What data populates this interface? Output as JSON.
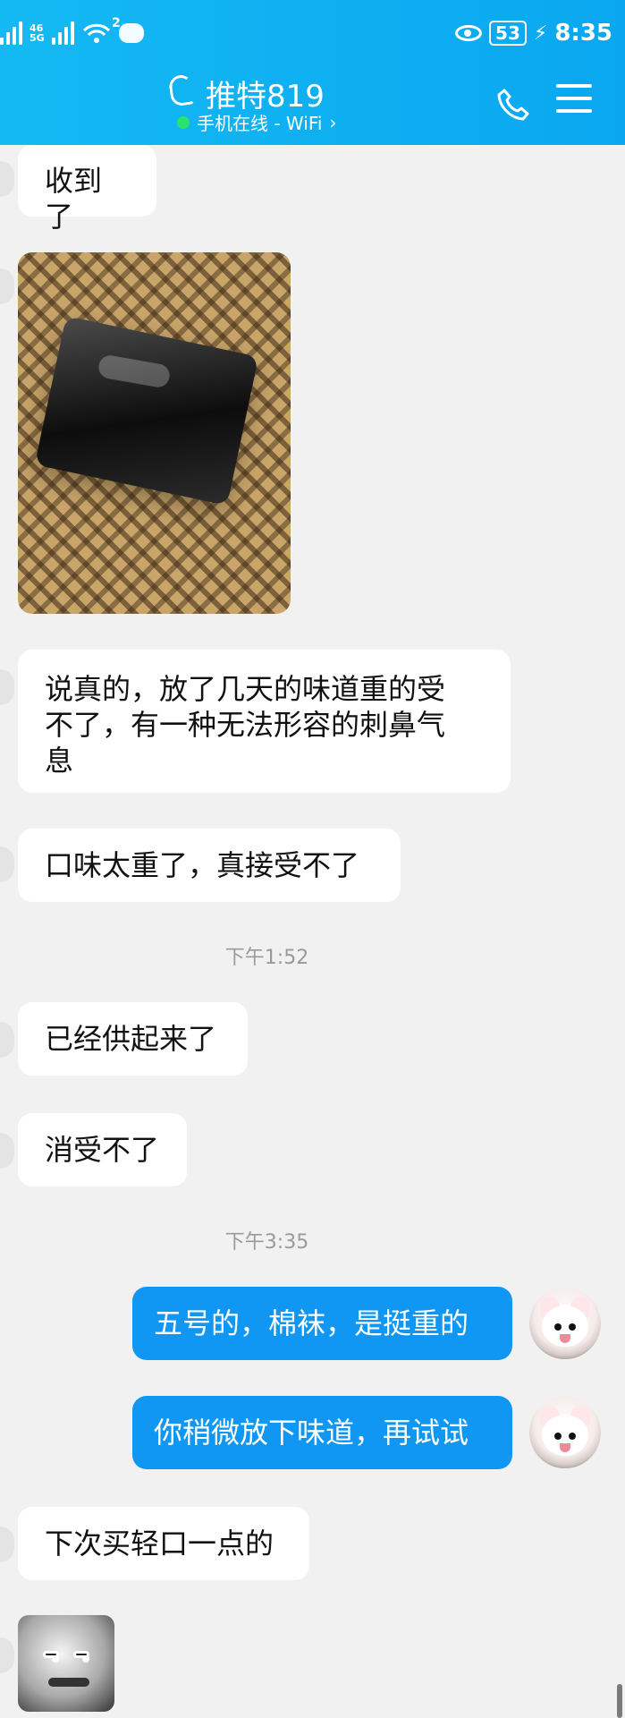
{
  "status_bar": {
    "left_signal_a": "46",
    "left_signal_b": "5G",
    "wifi_badge": "2",
    "battery": "53",
    "time": "8:35"
  },
  "chat_header": {
    "title": "推特819",
    "subtitle": "手机在线 - WiFi",
    "subtitle_chevron": "›"
  },
  "messages": [
    {
      "side": "left",
      "type": "text",
      "text": "收到了"
    },
    {
      "side": "left",
      "type": "image"
    },
    {
      "side": "left",
      "type": "text",
      "lines": [
        "说真的，放了几天的味道重的受",
        "不了，有一种无法形容的刺鼻气",
        "息"
      ]
    },
    {
      "side": "left",
      "type": "text",
      "text": "口味太重了，真接受不了"
    },
    {
      "type": "time",
      "text": "下午1:52"
    },
    {
      "side": "left",
      "type": "text",
      "text": "已经供起来了"
    },
    {
      "side": "left",
      "type": "text",
      "text": "消受不了"
    },
    {
      "type": "time",
      "text": "下午3:35"
    },
    {
      "side": "right",
      "type": "text",
      "text": "五号的，棉袜，是挺重的"
    },
    {
      "side": "right",
      "type": "text",
      "text": "你稍微放下味道，再试试"
    },
    {
      "side": "left",
      "type": "text",
      "text": "下次买轻口一点的"
    },
    {
      "side": "left",
      "type": "sticker"
    }
  ],
  "colors": {
    "header": "#0aa7f0",
    "right_bubble": "#0f97f3",
    "left_bubble": "#ffffff",
    "background": "#f1f1f1",
    "online_dot": "#2be36a"
  }
}
